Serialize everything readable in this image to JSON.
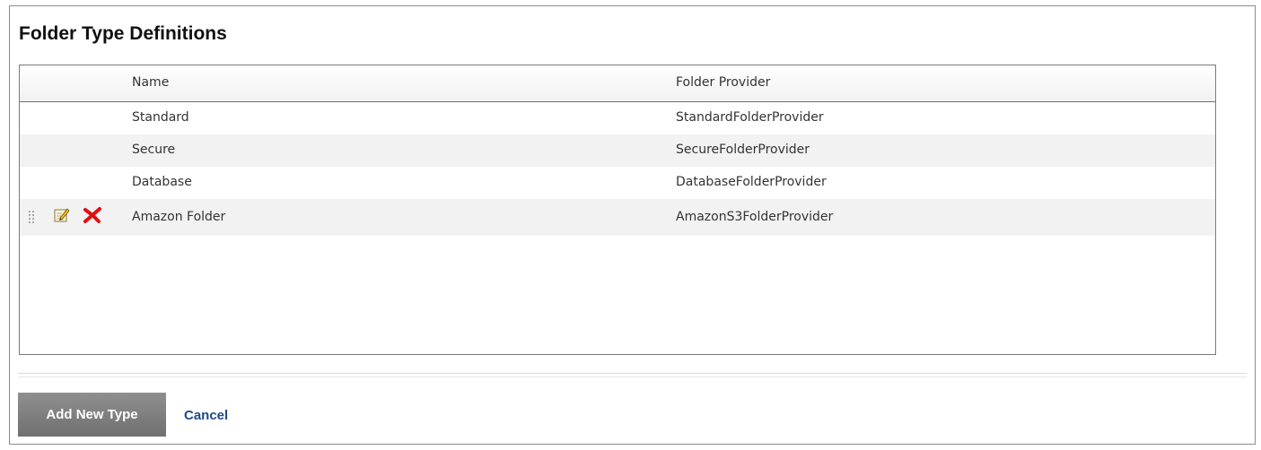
{
  "page": {
    "title": "Folder Type Definitions"
  },
  "grid": {
    "columns": {
      "name": "Name",
      "provider": "Folder Provider"
    },
    "rows": [
      {
        "name": "Standard",
        "provider": "StandardFolderProvider",
        "editable": false
      },
      {
        "name": "Secure",
        "provider": "SecureFolderProvider",
        "editable": false
      },
      {
        "name": "Database",
        "provider": "DatabaseFolderProvider",
        "editable": false
      },
      {
        "name": "Amazon Folder",
        "provider": "AmazonS3FolderProvider",
        "editable": true
      }
    ],
    "row_icons": [
      "drag-handle-icon",
      "edit-icon",
      "delete-icon"
    ]
  },
  "actions": {
    "add_label": "Add New Type",
    "cancel_label": "Cancel"
  },
  "colors": {
    "button_bg": "#7f7f7f",
    "link": "#1f4a87",
    "row_alt": "#f2f2f2",
    "delete_red": "#e01010"
  }
}
